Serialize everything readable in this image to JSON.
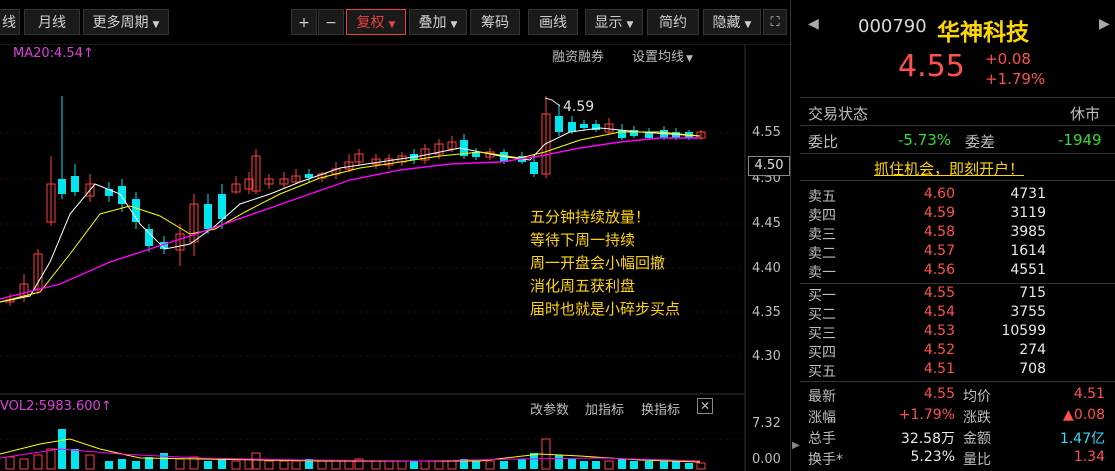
{
  "toolbar": {
    "left_cut": "线",
    "daily": "日线",
    "monthly": "月线",
    "more_period": "更多周期",
    "zoom_in": "+",
    "zoom_out": "−",
    "restore_right": "复权",
    "overlay": "叠加",
    "chips": "筹码",
    "draw_line": "画线",
    "display": "显示",
    "simple": "简约",
    "hide": "隐藏",
    "fullscreen_icon": "fullscreen-icon"
  },
  "chart": {
    "ma_label": "MA20:4.54",
    "margin_trading": "融资融券",
    "set_ma": "设置均线",
    "high_label": "4.59",
    "current_price_tag": "4.50",
    "price_ticks": [
      "4.55",
      "4.50",
      "4.45",
      "4.40",
      "4.35",
      "4.30"
    ],
    "annotation": [
      "五分钟持续放量！",
      "等待下周一持续",
      "周一开盘会小幅回撤",
      "消化周五获利盘",
      "届时也就是小碎步买点"
    ],
    "vol_label": "VOL2:5983.600",
    "change_param": "改参数",
    "add_indicator": "加指标",
    "switch_indicator": "换指标",
    "vol_ticks": [
      "7.32",
      "0.00"
    ],
    "colors": {
      "up": "#ff4040",
      "down": "#00e5ee",
      "ma5": "#ffffff",
      "ma10": "#ffff00",
      "ma20": "#ff00ff"
    }
  },
  "chart_data": {
    "type": "candlestick",
    "series": [
      {
        "name": "MA20",
        "values": [
          4.54
        ]
      },
      {
        "name": "VOL2",
        "values": [
          5983.6
        ]
      }
    ],
    "ylim": [
      4.3,
      4.55
    ]
  },
  "quote": {
    "code": "000790",
    "name": "华神科技",
    "price": "4.55",
    "change": "+0.08",
    "change_pct": "+1.79%",
    "trade_status_label": "交易状态",
    "trade_status": "休市",
    "weibi_label": "委比",
    "weibi": "-5.73%",
    "weicha_label": "委差",
    "weicha": "-1949",
    "promo": "抓住机会，即刻开户！",
    "asks": [
      {
        "label": "卖五",
        "price": "4.60",
        "vol": "4731"
      },
      {
        "label": "卖四",
        "price": "4.59",
        "vol": "3119"
      },
      {
        "label": "卖三",
        "price": "4.58",
        "vol": "3985"
      },
      {
        "label": "卖二",
        "price": "4.57",
        "vol": "1614"
      },
      {
        "label": "卖一",
        "price": "4.56",
        "vol": "4551"
      }
    ],
    "bids": [
      {
        "label": "买一",
        "price": "4.55",
        "vol": "715"
      },
      {
        "label": "买二",
        "price": "4.54",
        "vol": "3755"
      },
      {
        "label": "买三",
        "price": "4.53",
        "vol": "10599"
      },
      {
        "label": "买四",
        "price": "4.52",
        "vol": "274"
      },
      {
        "label": "买五",
        "price": "4.51",
        "vol": "708"
      }
    ],
    "stats": [
      {
        "l1": "最新",
        "v1": "4.55",
        "c1": "red",
        "l2": "均价",
        "v2": "4.51",
        "c2": "red"
      },
      {
        "l1": "涨幅",
        "v1": "+1.79%",
        "c1": "red",
        "l2": "涨跌",
        "v2": "▲0.08",
        "c2": "red"
      },
      {
        "l1": "总手",
        "v1": "32.58万",
        "c1": "wht",
        "l2": "金额",
        "v2": "1.47亿",
        "c2": "cyan"
      },
      {
        "l1": "换手*",
        "v1": "5.23%",
        "c1": "wht",
        "l2": "量比",
        "v2": "1.34",
        "c2": "red"
      }
    ]
  }
}
